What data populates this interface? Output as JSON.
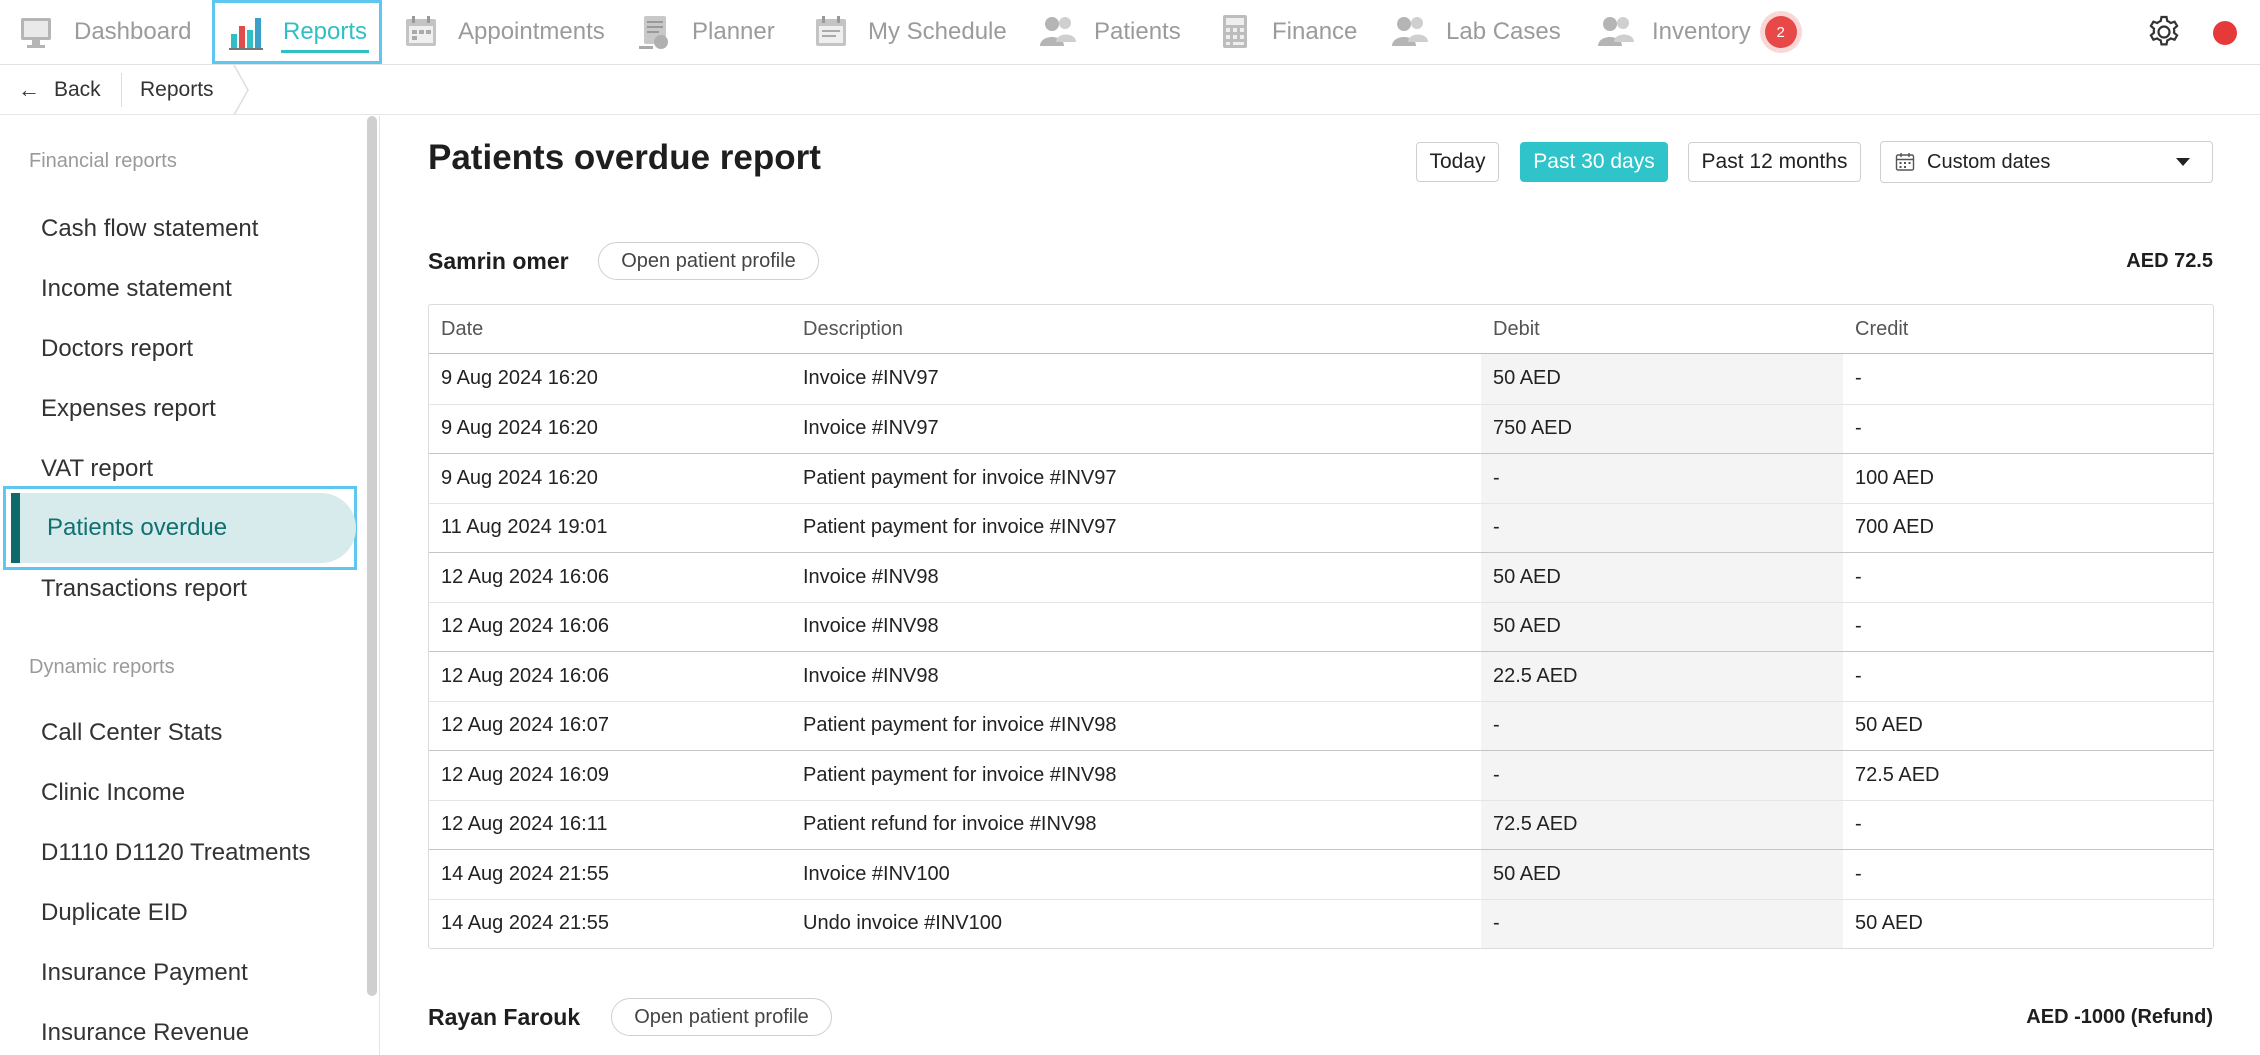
{
  "nav": {
    "items": [
      {
        "label": "Dashboard",
        "icon": "dashboard-icon"
      },
      {
        "label": "Reports",
        "icon": "reports-chart-icon",
        "active": true
      },
      {
        "label": "Appointments",
        "icon": "appointments-icon"
      },
      {
        "label": "Planner",
        "icon": "planner-icon"
      },
      {
        "label": "My Schedule",
        "icon": "schedule-icon"
      },
      {
        "label": "Patients",
        "icon": "patients-icon"
      },
      {
        "label": "Finance",
        "icon": "finance-calculator-icon"
      },
      {
        "label": "Lab Cases",
        "icon": "lab-cases-icon"
      },
      {
        "label": "Inventory",
        "icon": "inventory-icon"
      }
    ],
    "inventory_badge": "2"
  },
  "breadcrumb": {
    "back_label": "Back",
    "current": "Reports"
  },
  "sidebar": {
    "financial_heading": "Financial reports",
    "financial_items": [
      "Cash flow statement",
      "Income statement",
      "Doctors report",
      "Expenses report",
      "VAT report",
      "Patients overdue",
      "Transactions report"
    ],
    "active_item": "Patients overdue",
    "dynamic_heading": "Dynamic reports",
    "dynamic_items": [
      "Call Center Stats",
      "Clinic Income",
      "D1110 D1120 Treatments",
      "Duplicate EID",
      "Insurance Payment",
      "Insurance Revenue"
    ]
  },
  "page": {
    "title": "Patients overdue report",
    "filters": {
      "today": "Today",
      "past30": "Past 30 days",
      "past12": "Past 12 months",
      "selected": "Past 30 days"
    },
    "custom_dates": "Custom dates"
  },
  "table_headers": {
    "date": "Date",
    "description": "Description",
    "debit": "Debit",
    "credit": "Credit"
  },
  "patients": [
    {
      "name": "Samrin omer",
      "profile_button": "Open patient profile",
      "balance": "AED 72.5",
      "rows": [
        {
          "date": "9 Aug 2024 16:20",
          "description": "Invoice #INV97",
          "debit": "50 AED",
          "credit": "-"
        },
        {
          "date": "9 Aug 2024 16:20",
          "description": "Invoice #INV97",
          "debit": "750 AED",
          "credit": "-"
        },
        {
          "date": "9 Aug 2024 16:20",
          "description": "Patient payment for invoice #INV97",
          "debit": "-",
          "credit": "100 AED"
        },
        {
          "date": "11 Aug 2024 19:01",
          "description": "Patient payment for invoice #INV97",
          "debit": "-",
          "credit": "700 AED"
        },
        {
          "date": "12 Aug 2024 16:06",
          "description": "Invoice #INV98",
          "debit": "50 AED",
          "credit": "-"
        },
        {
          "date": "12 Aug 2024 16:06",
          "description": "Invoice #INV98",
          "debit": "50 AED",
          "credit": "-"
        },
        {
          "date": "12 Aug 2024 16:06",
          "description": "Invoice #INV98",
          "debit": "22.5 AED",
          "credit": "-"
        },
        {
          "date": "12 Aug 2024 16:07",
          "description": "Patient payment for invoice #INV98",
          "debit": "-",
          "credit": "50 AED"
        },
        {
          "date": "12 Aug 2024 16:09",
          "description": "Patient payment for invoice #INV98",
          "debit": "-",
          "credit": "72.5 AED"
        },
        {
          "date": "12 Aug 2024 16:11",
          "description": "Patient refund for invoice #INV98",
          "debit": "72.5 AED",
          "credit": "-"
        },
        {
          "date": "14 Aug 2024 21:55",
          "description": "Invoice #INV100",
          "debit": "50 AED",
          "credit": "-"
        },
        {
          "date": "14 Aug 2024 21:55",
          "description": "Undo invoice #INV100",
          "debit": "-",
          "credit": "50 AED"
        }
      ]
    },
    {
      "name": "Rayan Farouk",
      "profile_button": "Open patient profile",
      "balance": "AED -1000 (Refund)"
    }
  ],
  "colors": {
    "accent": "#2fc4c9",
    "active_nav": "#2fc0c6",
    "sidebar_active_bg": "#d7ebec",
    "sidebar_active_bar": "#0e6a6a",
    "badge": "#e74848"
  }
}
